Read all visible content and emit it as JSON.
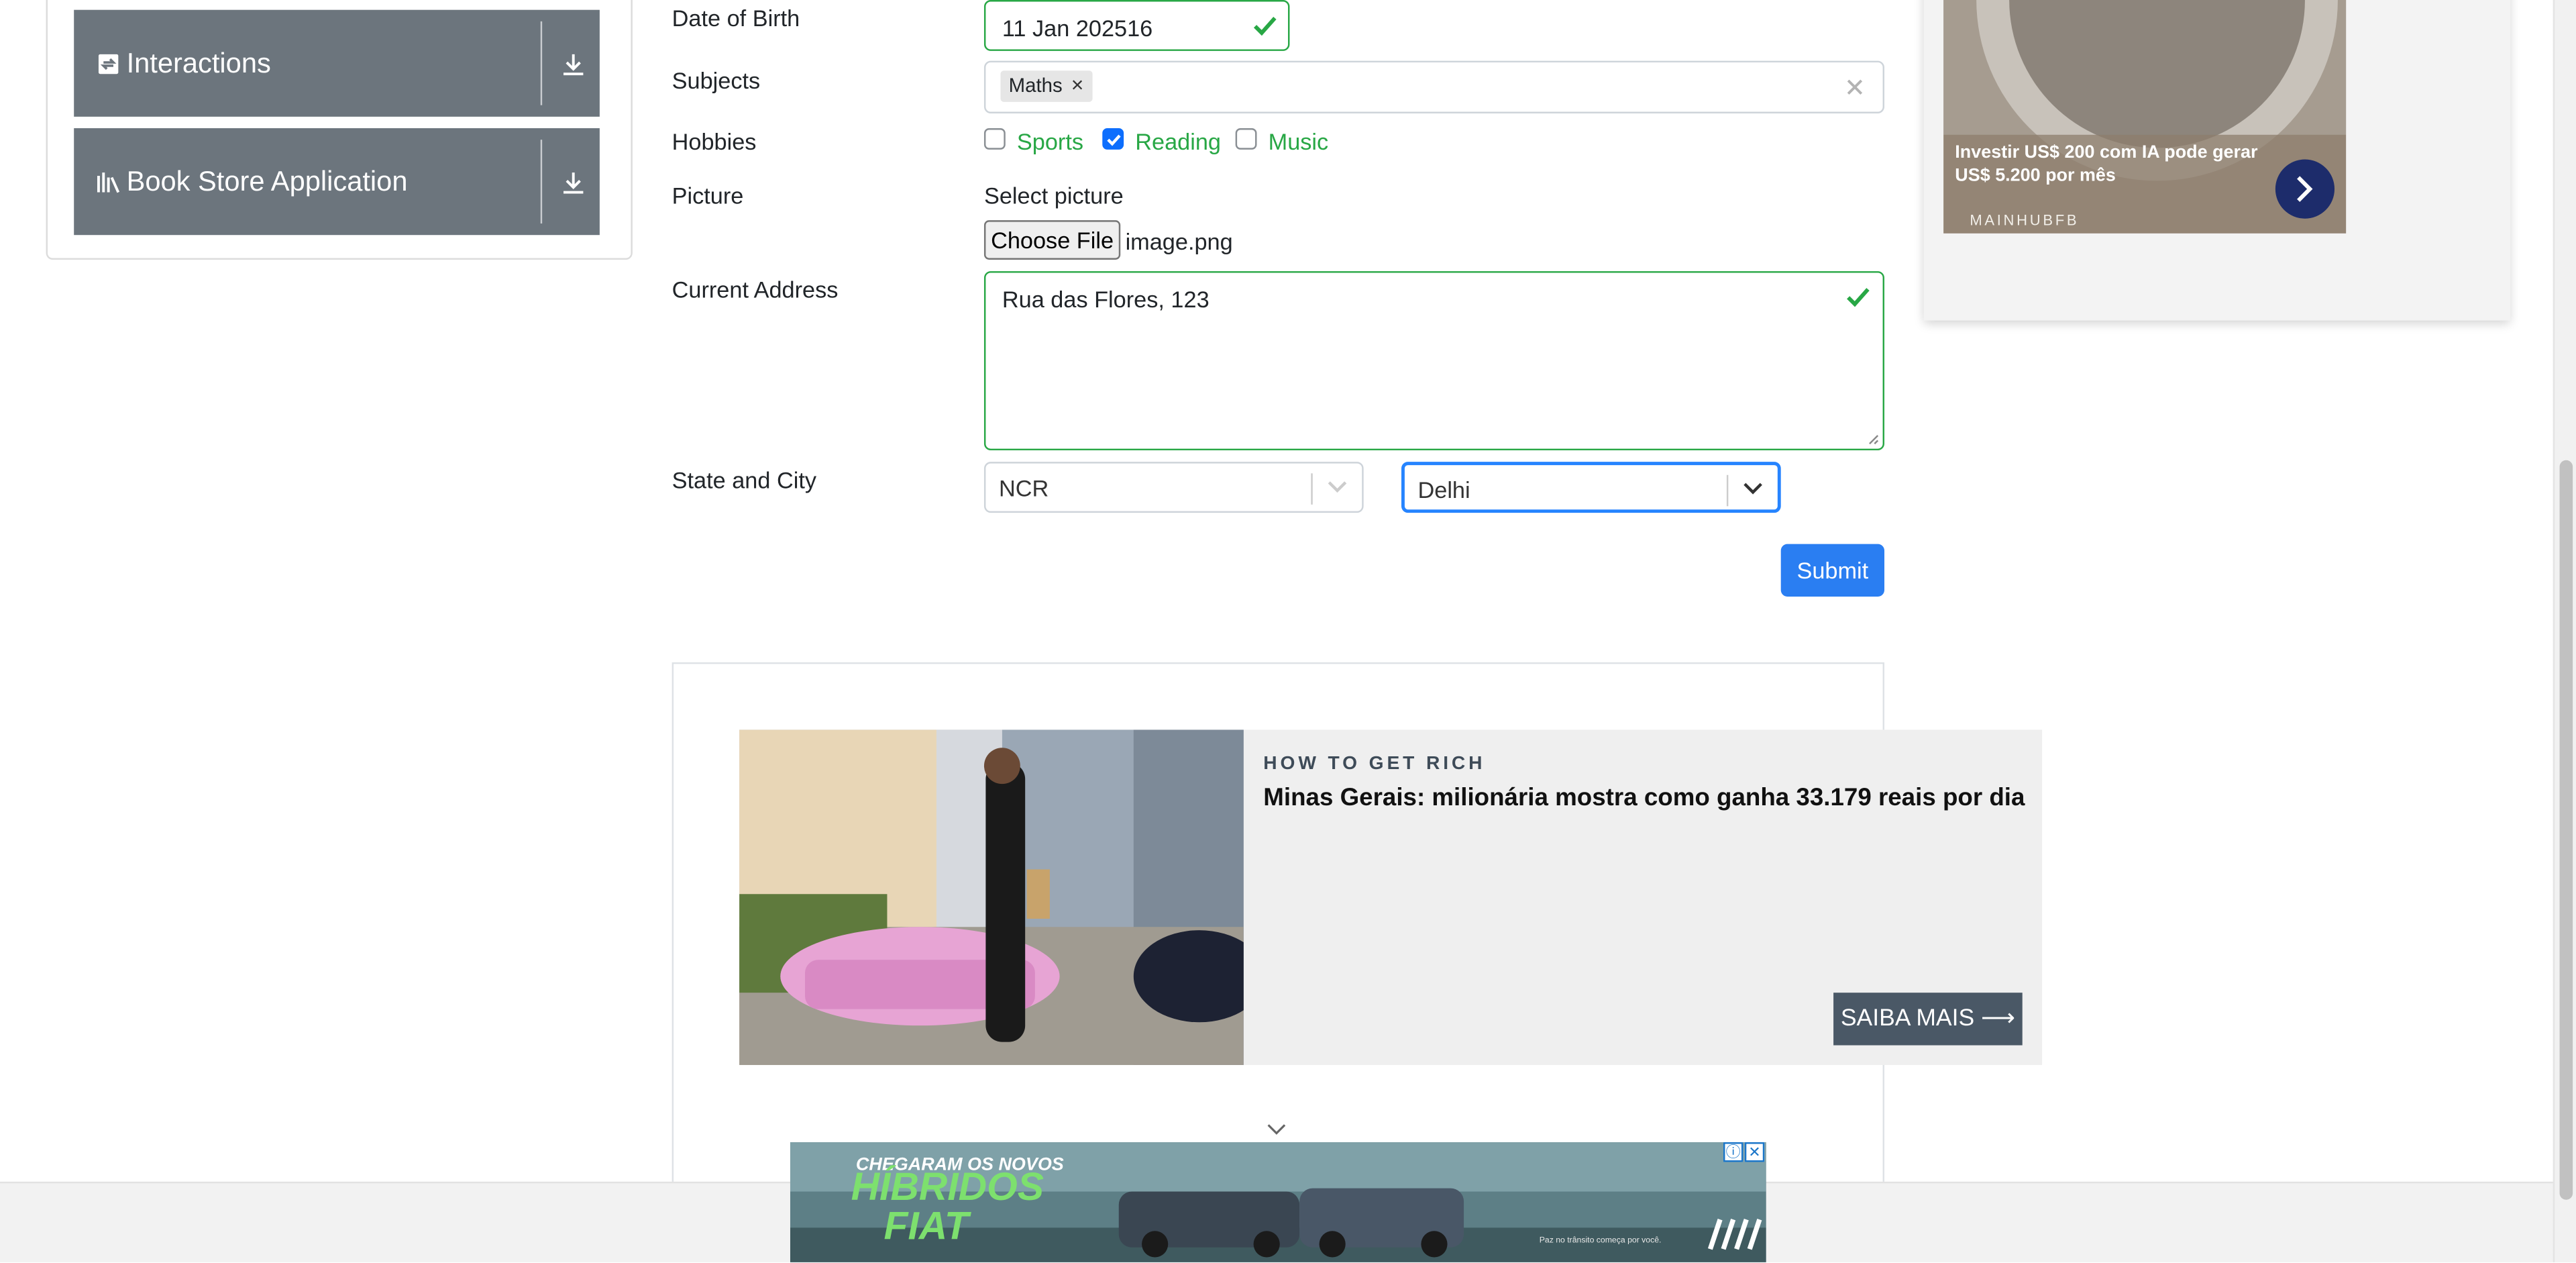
{
  "menu": {
    "groups": [
      {
        "title": "Interactions",
        "icon": "interactions-icon"
      },
      {
        "title": "Book Store Application",
        "icon": "books-icon"
      }
    ]
  },
  "form": {
    "dob": {
      "label": "Date of Birth",
      "value": "11 Jan 202516"
    },
    "subjects": {
      "label": "Subjects",
      "chips": [
        "Maths"
      ],
      "clear_glyph": "×"
    },
    "hobbies": {
      "label": "Hobbies",
      "options": [
        {
          "label": "Sports",
          "checked": false
        },
        {
          "label": "Reading",
          "checked": true
        },
        {
          "label": "Music",
          "checked": false
        }
      ]
    },
    "picture": {
      "label": "Picture",
      "select_label": "Select picture",
      "button": "Choose File",
      "filename": "image.png"
    },
    "address": {
      "label": "Current Address",
      "value": "Rua das Flores, 123"
    },
    "state_city": {
      "label": "State and City",
      "state": "NCR",
      "city": "Delhi"
    },
    "submit": "Submit"
  },
  "ads": {
    "native": {
      "kicker": "HOW TO GET RICH",
      "headline": "Minas Gerais: milionária mostra como ganha 33.179 reais por dia",
      "cta": "SAIBA MAIS ⟶"
    },
    "side": {
      "text": "Investir US$ 200 com IA pode gerar US$ 5.200 por mês",
      "source": "MAINHUBFB"
    },
    "banner": {
      "line1": "CHEGARAM OS NOVOS",
      "line2": "HÍBRIDOS",
      "line3": "FIAT",
      "small": "Paz no trânsito começa por você.",
      "info_glyph": "ⓘ",
      "close_glyph": "✕"
    }
  },
  "colors": {
    "accent": "#2a7ef2",
    "valid": "#28a745",
    "menu_header": "#6c757d",
    "focus_border": "#2684ff"
  }
}
